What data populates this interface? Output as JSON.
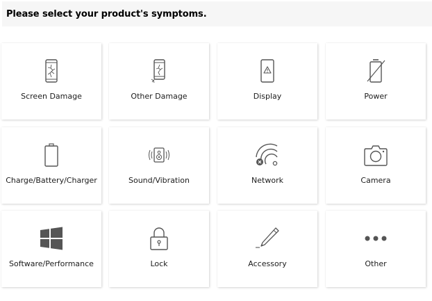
{
  "header": {
    "title": "Please select your product's symptoms."
  },
  "symptoms": [
    {
      "label": "Screen Damage",
      "icon": "cracked-screen-icon"
    },
    {
      "label": "Other Damage",
      "icon": "damaged-phone-icon"
    },
    {
      "label": "Display",
      "icon": "display-warning-icon"
    },
    {
      "label": "Power",
      "icon": "power-off-phone-icon"
    },
    {
      "label": "Charge/Battery/Charger",
      "icon": "battery-icon"
    },
    {
      "label": "Sound/Vibration",
      "icon": "speaker-vibration-icon"
    },
    {
      "label": "Network",
      "icon": "network-no-signal-icon"
    },
    {
      "label": "Camera",
      "icon": "camera-icon"
    },
    {
      "label": "Software/Performance",
      "icon": "windows-software-icon"
    },
    {
      "label": "Lock",
      "icon": "lock-icon"
    },
    {
      "label": "Accessory",
      "icon": "pen-accessory-icon"
    },
    {
      "label": "Other",
      "icon": "more-dots-icon"
    }
  ],
  "colors": {
    "icon": "#555555",
    "header_bg": "#f6f6f6",
    "text": "#1c1c1c"
  }
}
